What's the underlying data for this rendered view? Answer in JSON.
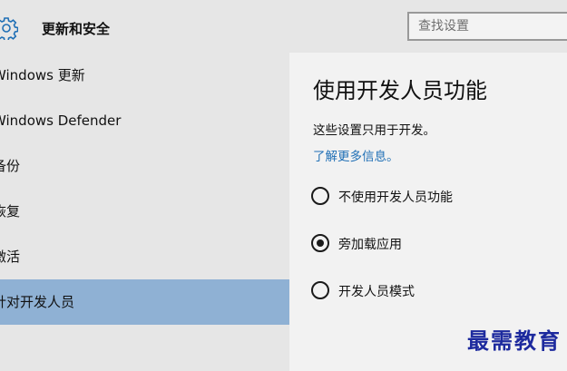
{
  "header": {
    "title": "更新和安全",
    "search_placeholder": "查找设置",
    "icon": "gear-icon"
  },
  "sidebar": {
    "items": [
      {
        "label": "Windows 更新",
        "selected": false
      },
      {
        "label": "Windows Defender",
        "selected": false
      },
      {
        "label": "备份",
        "selected": false
      },
      {
        "label": "恢复",
        "selected": false
      },
      {
        "label": "激活",
        "selected": false
      },
      {
        "label": "针对开发人员",
        "selected": true
      }
    ]
  },
  "content": {
    "title": "使用开发人员功能",
    "description": "这些设置只用于开发。",
    "learn_more": "了解更多信息。",
    "options": [
      {
        "label": "不使用开发人员功能",
        "checked": false
      },
      {
        "label": "旁加载应用",
        "checked": true
      },
      {
        "label": "开发人员模式",
        "checked": false
      }
    ]
  },
  "watermark": "最需教育",
  "colors": {
    "accent_link": "#1f6fb5",
    "selected_nav": "#8fb1d4",
    "watermark": "#1d2a9e"
  }
}
